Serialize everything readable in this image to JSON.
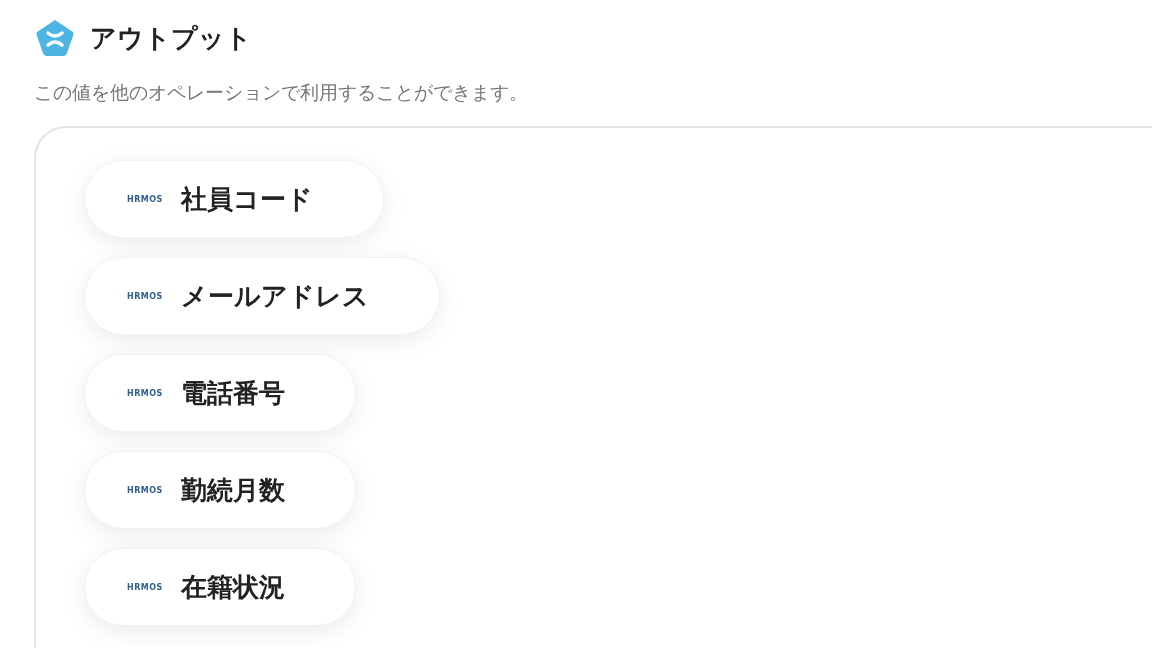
{
  "header": {
    "title": "アウトプット",
    "description": "この値を他のオペレーションで利用することができます。"
  },
  "outputs": [
    {
      "logo": "HRMOS",
      "label": "社員コード"
    },
    {
      "logo": "HRMOS",
      "label": "メールアドレス"
    },
    {
      "logo": "HRMOS",
      "label": "電話番号"
    },
    {
      "logo": "HRMOS",
      "label": "勤続月数"
    },
    {
      "logo": "HRMOS",
      "label": "在籍状況"
    }
  ]
}
